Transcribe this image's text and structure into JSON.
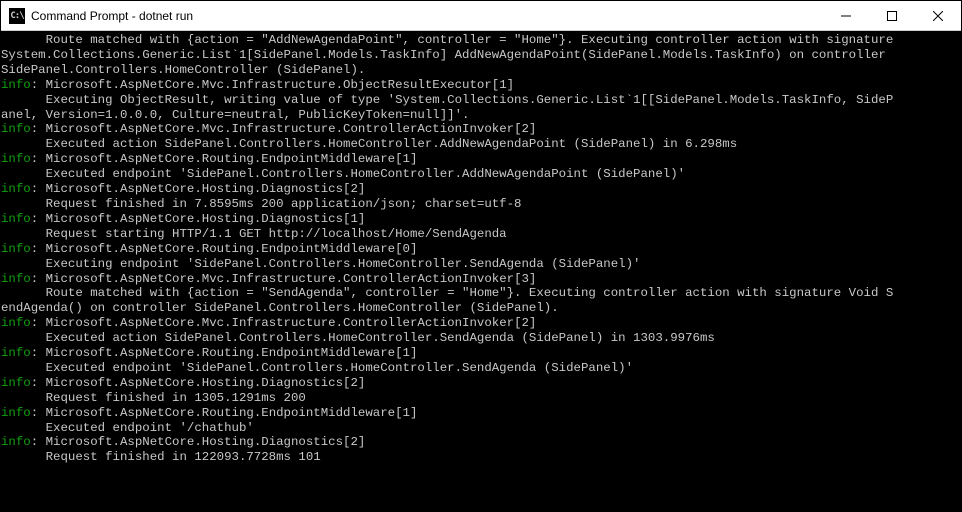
{
  "window": {
    "icon_label": "C:\\",
    "title": "Command Prompt - dotnet  run"
  },
  "prefixes": {
    "info": "info",
    "colon": ": ",
    "indent": "      "
  },
  "lines": [
    {
      "type": "body",
      "text": "      Route matched with {action = \"AddNewAgendaPoint\", controller = \"Home\"}. Executing controller action with signature "
    },
    {
      "type": "body",
      "text": "System.Collections.Generic.List`1[SidePanel.Models.TaskInfo] AddNewAgendaPoint(SidePanel.Models.TaskInfo) on controller "
    },
    {
      "type": "body",
      "text": "SidePanel.Controllers.HomeController (SidePanel)."
    },
    {
      "type": "info",
      "text": "Microsoft.AspNetCore.Mvc.Infrastructure.ObjectResultExecutor[1]"
    },
    {
      "type": "body",
      "text": "      Executing ObjectResult, writing value of type 'System.Collections.Generic.List`1[[SidePanel.Models.TaskInfo, SideP"
    },
    {
      "type": "body",
      "text": "anel, Version=1.0.0.0, Culture=neutral, PublicKeyToken=null]]'."
    },
    {
      "type": "info",
      "text": "Microsoft.AspNetCore.Mvc.Infrastructure.ControllerActionInvoker[2]"
    },
    {
      "type": "body",
      "text": "      Executed action SidePanel.Controllers.HomeController.AddNewAgendaPoint (SidePanel) in 6.298ms"
    },
    {
      "type": "info",
      "text": "Microsoft.AspNetCore.Routing.EndpointMiddleware[1]"
    },
    {
      "type": "body",
      "text": "      Executed endpoint 'SidePanel.Controllers.HomeController.AddNewAgendaPoint (SidePanel)'"
    },
    {
      "type": "info",
      "text": "Microsoft.AspNetCore.Hosting.Diagnostics[2]"
    },
    {
      "type": "body",
      "text": "      Request finished in 7.8595ms 200 application/json; charset=utf-8"
    },
    {
      "type": "info",
      "text": "Microsoft.AspNetCore.Hosting.Diagnostics[1]"
    },
    {
      "type": "body",
      "text": "      Request starting HTTP/1.1 GET http://localhost/Home/SendAgenda"
    },
    {
      "type": "info",
      "text": "Microsoft.AspNetCore.Routing.EndpointMiddleware[0]"
    },
    {
      "type": "body",
      "text": "      Executing endpoint 'SidePanel.Controllers.HomeController.SendAgenda (SidePanel)'"
    },
    {
      "type": "info",
      "text": "Microsoft.AspNetCore.Mvc.Infrastructure.ControllerActionInvoker[3]"
    },
    {
      "type": "body",
      "text": "      Route matched with {action = \"SendAgenda\", controller = \"Home\"}. Executing controller action with signature Void S"
    },
    {
      "type": "body",
      "text": "endAgenda() on controller SidePanel.Controllers.HomeController (SidePanel)."
    },
    {
      "type": "info",
      "text": "Microsoft.AspNetCore.Mvc.Infrastructure.ControllerActionInvoker[2]"
    },
    {
      "type": "body",
      "text": "      Executed action SidePanel.Controllers.HomeController.SendAgenda (SidePanel) in 1303.9976ms"
    },
    {
      "type": "info",
      "text": "Microsoft.AspNetCore.Routing.EndpointMiddleware[1]"
    },
    {
      "type": "body",
      "text": "      Executed endpoint 'SidePanel.Controllers.HomeController.SendAgenda (SidePanel)'"
    },
    {
      "type": "info",
      "text": "Microsoft.AspNetCore.Hosting.Diagnostics[2]"
    },
    {
      "type": "body",
      "text": "      Request finished in 1305.1291ms 200"
    },
    {
      "type": "info",
      "text": "Microsoft.AspNetCore.Routing.EndpointMiddleware[1]"
    },
    {
      "type": "body",
      "text": "      Executed endpoint '/chathub'"
    },
    {
      "type": "info",
      "text": "Microsoft.AspNetCore.Hosting.Diagnostics[2]"
    },
    {
      "type": "body",
      "text": "      Request finished in 122093.7728ms 101"
    }
  ]
}
